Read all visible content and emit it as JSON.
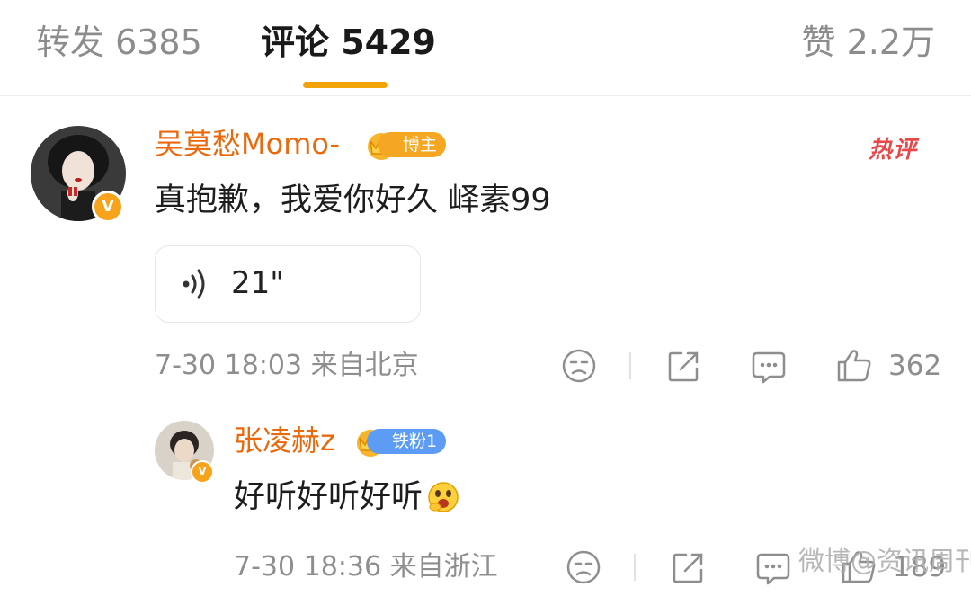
{
  "tabs": {
    "repost": "转发 6385",
    "comments": "评论 5429",
    "likes": "赞 2.2万"
  },
  "colors": {
    "accent": "#f2a20a",
    "username": "#e9690c",
    "hot": "#e8484a"
  },
  "comment": {
    "username": "吴莫愁Momo-",
    "badge": "博主",
    "hot_label": "热评",
    "text": "真抱歉，我爱你好久 峄素99",
    "voice_duration": "21\"",
    "meta": "7-30 18:03  来自北京",
    "likes": "362",
    "verified": "V"
  },
  "reply": {
    "username": "张凌赫z",
    "badge": "铁粉1",
    "text": "好听好听好听",
    "emoji": "grinning-emoji",
    "meta": "7-30 18:36  来自浙江",
    "likes": "189",
    "verified": "V"
  },
  "watermark": "微博@资讯周刊",
  "icons": [
    "dislike-icon",
    "share-icon",
    "comment-icon",
    "like-icon",
    "voice-wave-icon",
    "crown-icon"
  ]
}
